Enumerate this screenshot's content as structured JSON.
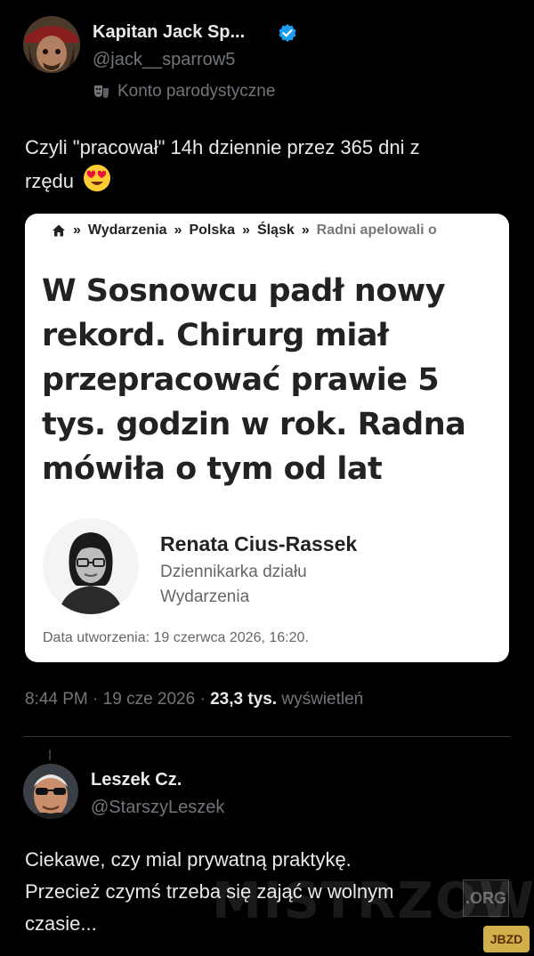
{
  "tweet": {
    "author_name": "Kapitan Jack Sp...",
    "author_handle": "@jack__sparrow5",
    "parody_label": "Konto parodystyczne",
    "text_line1": "Czyli \"pracował\" 14h dziennie przez 365 dni z",
    "text_line2": "rzędu",
    "emoji": "😍",
    "time": "8:44 PM",
    "date": "19 cze 2026",
    "views_count": "23,3 tys.",
    "views_label": "wyświetleń",
    "dot": "·"
  },
  "card": {
    "breadcrumbs": [
      "Wydarzenia",
      "Polska",
      "Śląsk"
    ],
    "breadcrumb_last": "Radni apelowali o",
    "separator": "»",
    "title": "W Sosnowcu padł nowy rekord. Chirurg miał przepracować prawie 5 tys. godzin w rok. Radna mówiła o tym od lat",
    "author_name": "Renata Cius-Rassek",
    "author_role_line1": "Dziennikarka działu",
    "author_role_line2": "Wydarzenia",
    "created": "Data utworzenia: 19 czerwca 2026, 16:20."
  },
  "reply": {
    "author_name": "Leszek Cz.",
    "author_handle": "@StarszyLeszek",
    "text_line1": "Ciekawe, czy mial prywatną praktykę.",
    "text_line2": "Przecież czymś trzeba się zająć w wolnym",
    "text_line3": "czasie..."
  },
  "watermark": {
    "text": "MISTRZOWIE",
    "suffix": ".ORG",
    "badge": "JBZD"
  },
  "colors": {
    "background": "#000000",
    "text": "#e7e9ea",
    "muted": "#71767b",
    "verified": "#1d9bf0"
  }
}
